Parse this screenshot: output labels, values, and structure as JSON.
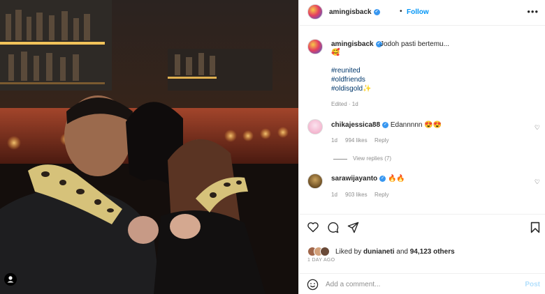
{
  "post": {
    "username": "amingisback",
    "follow_label": "Follow",
    "more_label": "•••",
    "caption_text": "Jodoh pasti bertemu...",
    "caption_emoji": "🥰",
    "hashtags": [
      "#reunited",
      "#oldfriends",
      "#oldisgold"
    ],
    "hashtag_emoji": "✨",
    "edited": "Edited · 1d"
  },
  "comments": [
    {
      "username": "chikajessica88",
      "text": "Edannnnn 😍😍",
      "age": "1d",
      "likes": "994 likes",
      "reply": "Reply",
      "view_replies": "View replies (7)"
    },
    {
      "username": "sarawijayanto",
      "text": "🔥🔥",
      "age": "1d",
      "likes": "903 likes",
      "reply": "Reply"
    }
  ],
  "likes": {
    "prefix": "Liked by",
    "user": "dunianeti",
    "joiner": "and",
    "count": "94,123 others"
  },
  "time_ago": "1 DAY AGO",
  "comment_box": {
    "placeholder": "Add a comment...",
    "post_label": "Post"
  },
  "colors": {
    "accent": "#0095f6",
    "verified": "#3897f0",
    "hashtag": "#00376b",
    "muted": "#8e8e8e"
  },
  "icons": [
    "heart-icon",
    "comment-icon",
    "share-icon",
    "bookmark-icon",
    "smile-icon",
    "verified-badge-icon",
    "person-tag-icon"
  ]
}
